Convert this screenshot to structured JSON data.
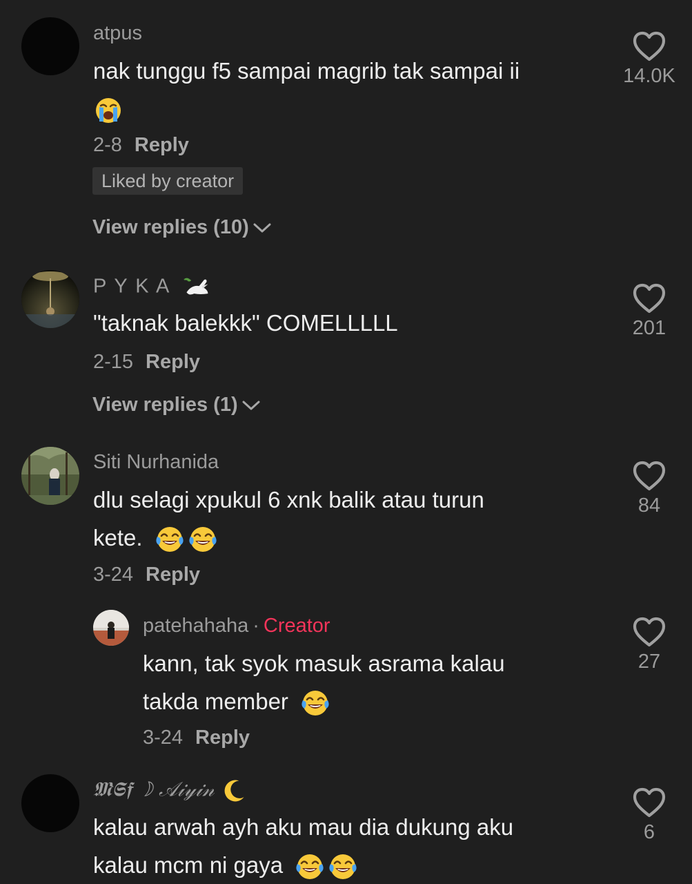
{
  "comments": [
    {
      "username": "atpus",
      "text": "nak tunggu f5 sampai magrib tak sampai ii",
      "emojis": [
        "loudly-crying-face-emoji"
      ],
      "date": "2-8",
      "reply_label": "Reply",
      "badge": "Liked by creator",
      "view_replies": "View replies (10)",
      "likes": "14.0K"
    },
    {
      "username": "P Y K A",
      "username_emoji": "dove-emoji",
      "text": "\"taknak balekkk\" COMELLLLL",
      "date": "2-15",
      "reply_label": "Reply",
      "view_replies": "View replies (1)",
      "likes": "201"
    },
    {
      "username": "Siti Nurhanida",
      "text_line1": "dlu selagi xpukul 6 xnk balik atau turun",
      "text_line2": "kete.",
      "emojis": [
        "tears-of-joy-emoji",
        "tears-of-joy-emoji"
      ],
      "date": "3-24",
      "reply_label": "Reply",
      "likes": "84"
    },
    {
      "username": "patehahaha",
      "separator": "·",
      "creator_label": "Creator",
      "text_line1": "kann, tak syok masuk asrama kalau",
      "text_line2": "takda member",
      "emojis": [
        "tears-of-joy-emoji"
      ],
      "date": "3-24",
      "reply_label": "Reply",
      "likes": "27"
    },
    {
      "username": "𝕸𝕾𝖋 ☽ 𝒜𝒾𝓎𝒾𝓃",
      "username_emoji": "crescent-moon-emoji",
      "text_line1": "kalau arwah ayh aku mau dia dukung aku",
      "text_line2": "kalau mcm ni gaya",
      "emojis": [
        "tears-of-joy-emoji",
        "tears-of-joy-emoji"
      ],
      "likes": "6"
    }
  ],
  "colors": {
    "background": "#1f1f1f",
    "text": "#ededed",
    "muted": "#9b9b9b",
    "creator": "#f3345a",
    "badge_bg": "#333333"
  }
}
